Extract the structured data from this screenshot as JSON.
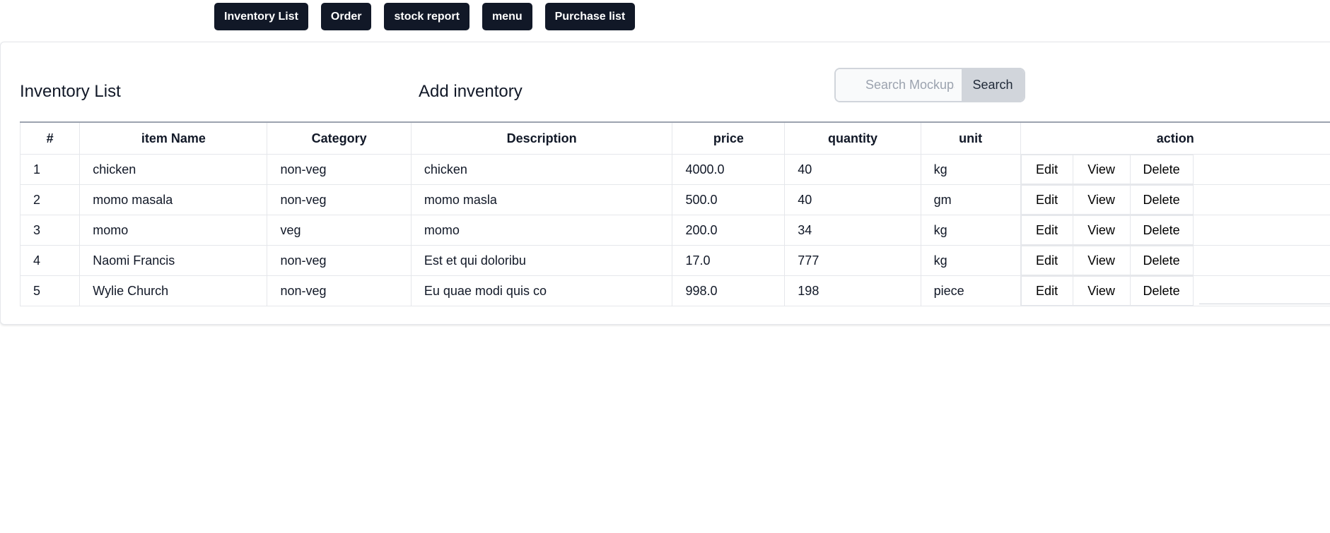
{
  "nav": {
    "buttons": [
      "Inventory List",
      "Order",
      "stock report",
      "menu",
      "Purchase list"
    ]
  },
  "page": {
    "title": "Inventory List",
    "add_link": "Add inventory"
  },
  "search": {
    "placeholder": "Search Mockups, Logos...",
    "button_label": "Search"
  },
  "table": {
    "headers": [
      "#",
      "item Name",
      "Category",
      "Description",
      "price",
      "quantity",
      "unit",
      "action"
    ],
    "rows": [
      [
        "1",
        "chicken",
        "non-veg",
        "chicken",
        "4000.0",
        "40",
        "kg"
      ],
      [
        "2",
        "momo masala",
        "non-veg",
        "momo masla",
        "500.0",
        "40",
        "gm"
      ],
      [
        "3",
        "momo",
        "veg",
        "momo",
        "200.0",
        "34",
        "kg"
      ],
      [
        "4",
        "Naomi Francis",
        "non-veg",
        "Est et qui doloribu",
        "17.0",
        "777",
        "kg"
      ],
      [
        "5",
        "Wylie Church",
        "non-veg",
        "Eu quae modi quis co",
        "998.0",
        "198",
        "piece"
      ]
    ],
    "actions": [
      "Edit",
      "View",
      "Delete"
    ]
  },
  "colors": {
    "nav_bg": "#111827",
    "search_button_bg": "#d1d5db"
  }
}
